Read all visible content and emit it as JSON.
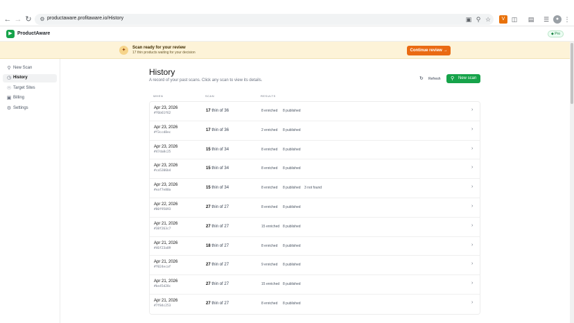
{
  "browser": {
    "url": "productaware.profitaware.io/History"
  },
  "app": {
    "brand": "ProductAware",
    "plan_badge": "Pro"
  },
  "banner": {
    "title": "Scan ready for your review",
    "subtitle": "17 thin products waiting for your decision",
    "button": "Continue review  →"
  },
  "sidebar": {
    "items": [
      {
        "label": "New Scan",
        "icon": "search-icon",
        "active": false
      },
      {
        "label": "History",
        "icon": "history-icon",
        "active": true
      },
      {
        "label": "Target Sites",
        "icon": "globe-icon",
        "active": false
      },
      {
        "label": "Billing",
        "icon": "card-icon",
        "active": false
      },
      {
        "label": "Settings",
        "icon": "gear-icon",
        "active": false
      }
    ]
  },
  "page": {
    "title": "History",
    "subtitle": "A record of your past scans. Click any scan to view its details.",
    "refresh": "Refresh",
    "new_scan": "New scan"
  },
  "table": {
    "columns": [
      "WHEN",
      "SCAN",
      "RESULTS"
    ],
    "rows": [
      {
        "date": "Apr 23, 2026",
        "id": "#f6b61f62",
        "n": "17",
        "of": "thin of 36",
        "r1": "8 enriched",
        "r2": "8 published",
        "r3": ""
      },
      {
        "date": "Apr 23, 2026",
        "id": "#f3ccd8ec",
        "n": "17",
        "of": "thin of 36",
        "r1": "2 enriched",
        "r2": "8 published",
        "r3": ""
      },
      {
        "date": "Apr 23, 2026",
        "id": "#47da8c25",
        "n": "15",
        "of": "thin of 34",
        "r1": "8 enriched",
        "r2": "8 published",
        "r3": ""
      },
      {
        "date": "Apr 23, 2026",
        "id": "#ca5206b4",
        "n": "15",
        "of": "thin of 34",
        "r1": "8 enriched",
        "r2": "8 published",
        "r3": ""
      },
      {
        "date": "Apr 23, 2026",
        "id": "#eaf7e80a",
        "n": "15",
        "of": "thin of 34",
        "r1": "8 enriched",
        "r2": "8 published",
        "r3": "3 not found"
      },
      {
        "date": "Apr 22, 2026",
        "id": "#80f95093",
        "n": "27",
        "of": "thin of 27",
        "r1": "8 enriched",
        "r2": "8 published",
        "r3": ""
      },
      {
        "date": "Apr 21, 2026",
        "id": "#38f263c7",
        "n": "27",
        "of": "thin of 27",
        "r1": "15 enriched",
        "r2": "8 published",
        "r3": ""
      },
      {
        "date": "Apr 21, 2026",
        "id": "#46f23a89",
        "n": "18",
        "of": "thin of 27",
        "r1": "8 enriched",
        "r2": "8 published",
        "r3": ""
      },
      {
        "date": "Apr 21, 2026",
        "id": "#f024ecaf",
        "n": "27",
        "of": "thin of 27",
        "r1": "9 enriched",
        "r2": "8 published",
        "r3": ""
      },
      {
        "date": "Apr 21, 2026",
        "id": "#be45d28c",
        "n": "27",
        "of": "thin of 27",
        "r1": "15 enriched",
        "r2": "8 published",
        "r3": ""
      },
      {
        "date": "Apr 21, 2026",
        "id": "#7f84c253",
        "n": "27",
        "of": "thin of 27",
        "r1": "8 enriched",
        "r2": "8 published",
        "r3": ""
      }
    ]
  }
}
